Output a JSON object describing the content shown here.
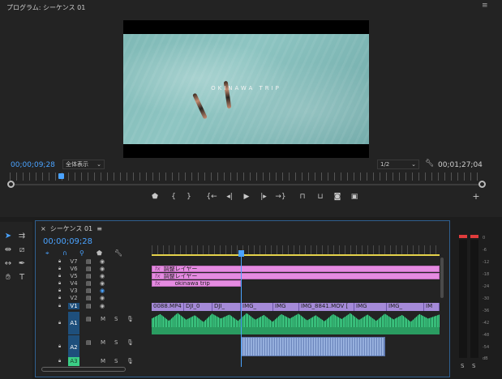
{
  "program_monitor": {
    "title": "プログラム: シーケンス 01",
    "menu_icon": "hamburger-icon",
    "video_overlay_title": "OKINAWA TRIP",
    "timecode_current": "00;00;09;28",
    "fit_select": "全体表示",
    "resolution_select": "1/2",
    "timecode_duration": "00;01;27;04",
    "transport": [
      "marker-icon",
      "mark-in-icon",
      "mark-out-icon",
      "go-to-in-icon",
      "step-back-icon",
      "play-icon",
      "step-forward-icon",
      "go-to-out-icon",
      "lift-icon",
      "extract-icon",
      "export-frame-icon",
      "comparison-view-icon",
      "add-button-icon"
    ]
  },
  "tools": [
    "selection-tool",
    "track-select-tool",
    "ripple-edit-tool",
    "razor-tool",
    "slip-tool",
    "pen-tool",
    "hand-tool",
    "type-tool"
  ],
  "timeline": {
    "tab_close": "×",
    "tab_label": "シーケンス 01",
    "tab_menu": "≡",
    "timecode": "00;00;09;28",
    "video_tracks": [
      {
        "name": "V7",
        "targeted": false
      },
      {
        "name": "V6",
        "targeted": false
      },
      {
        "name": "V5",
        "targeted": false
      },
      {
        "name": "V4",
        "targeted": false
      },
      {
        "name": "V3",
        "targeted": false
      },
      {
        "name": "V2",
        "targeted": false
      },
      {
        "name": "V1",
        "targeted": true
      }
    ],
    "adjustment_clips": [
      {
        "track": "V6",
        "label": "調整レイヤー"
      },
      {
        "track": "V5",
        "label": "調整レイヤー"
      },
      {
        "track": "V4",
        "label": "okinawa trip"
      }
    ],
    "v1_clips": [
      "0088.MP4",
      "DJI_0",
      "DJI_",
      "IMG_",
      "IMG",
      "IMG_8841.MOV [",
      "IMG",
      "IMG_",
      "IM"
    ],
    "audio_tracks": [
      {
        "name": "A1",
        "mute": "M",
        "solo": "S"
      },
      {
        "name": "A2",
        "mute": "M",
        "solo": "S"
      },
      {
        "name": "A3",
        "mute": "M",
        "solo": "S"
      }
    ]
  },
  "meters": {
    "scale": [
      "0",
      "-6",
      "-12",
      "-18",
      "-24",
      "-30",
      "-36",
      "-42",
      "-48",
      "-54",
      "dB"
    ],
    "solo_labels": [
      "S",
      "S"
    ]
  }
}
